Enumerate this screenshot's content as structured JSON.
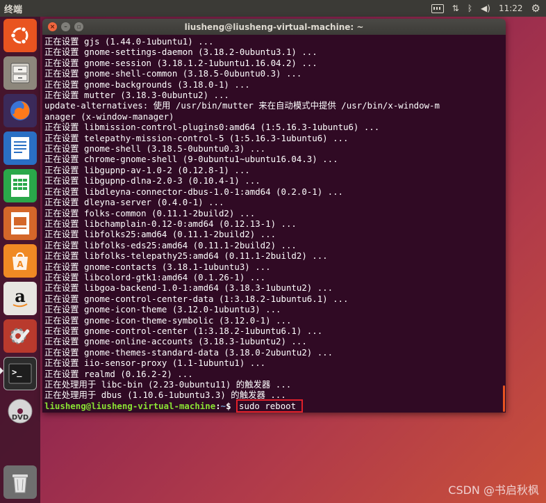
{
  "top_panel": {
    "app_title": "终端",
    "clock": "11:22",
    "icons": [
      "keyboard-icon",
      "network-icon",
      "bluetooth-icon",
      "volume-icon",
      "settings-icon"
    ]
  },
  "launcher": {
    "items": [
      {
        "name": "dash-home",
        "icon": "ubuntu-logo-icon",
        "color": "#e95420"
      },
      {
        "name": "files",
        "icon": "file-cabinet-icon",
        "color": "#a39e93"
      },
      {
        "name": "firefox",
        "icon": "firefox-icon",
        "color": "#ff7139"
      },
      {
        "name": "writer",
        "icon": "libreoffice-writer-icon",
        "color": "#2a6fc4"
      },
      {
        "name": "calc",
        "icon": "libreoffice-calc-icon",
        "color": "#2aa84a"
      },
      {
        "name": "impress",
        "icon": "libreoffice-impress-icon",
        "color": "#d4672a"
      },
      {
        "name": "software-center",
        "icon": "shopping-bag-icon",
        "color": "#f08a24"
      },
      {
        "name": "amazon",
        "icon": "amazon-icon",
        "color": "#e8e6e1"
      },
      {
        "name": "system-settings",
        "icon": "settings-wrench-icon",
        "color": "#b93a2d"
      },
      {
        "name": "terminal",
        "icon": "terminal-icon",
        "color": "#2c2c2c"
      },
      {
        "name": "dvd",
        "icon": "dvd-icon",
        "color": "#c9c9c9"
      },
      {
        "name": "trash",
        "icon": "trash-icon",
        "color": "#6f6f6f"
      }
    ]
  },
  "terminal": {
    "title": "liusheng@liusheng-virtual-machine: ~",
    "lines": [
      "正在设置 gjs (1.44.0-1ubuntu1) ...",
      "正在设置 gnome-settings-daemon (3.18.2-0ubuntu3.1) ...",
      "正在设置 gnome-session (3.18.1.2-1ubuntu1.16.04.2) ...",
      "正在设置 gnome-shell-common (3.18.5-0ubuntu0.3) ...",
      "正在设置 gnome-backgrounds (3.18.0-1) ...",
      "正在设置 mutter (3.18.3-0ubuntu2) ...",
      "update-alternatives: 使用 /usr/bin/mutter 来在自动模式中提供 /usr/bin/x-window-m",
      "anager (x-window-manager)",
      "正在设置 libmission-control-plugins0:amd64 (1:5.16.3-1ubuntu6) ...",
      "正在设置 telepathy-mission-control-5 (1:5.16.3-1ubuntu6) ...",
      "正在设置 gnome-shell (3.18.5-0ubuntu0.3) ...",
      "正在设置 chrome-gnome-shell (9-0ubuntu1~ubuntu16.04.3) ...",
      "正在设置 libgupnp-av-1.0-2 (0.12.8-1) ...",
      "正在设置 libgupnp-dlna-2.0-3 (0.10.4-1) ...",
      "正在设置 libdleyna-connector-dbus-1.0-1:amd64 (0.2.0-1) ...",
      "正在设置 dleyna-server (0.4.0-1) ...",
      "正在设置 folks-common (0.11.1-2build2) ...",
      "正在设置 libchamplain-0.12-0:amd64 (0.12.13-1) ...",
      "正在设置 libfolks25:amd64 (0.11.1-2build2) ...",
      "正在设置 libfolks-eds25:amd64 (0.11.1-2build2) ...",
      "正在设置 libfolks-telepathy25:amd64 (0.11.1-2build2) ...",
      "正在设置 gnome-contacts (3.18.1-1ubuntu3) ...",
      "正在设置 libcolord-gtk1:amd64 (0.1.26-1) ...",
      "正在设置 libgoa-backend-1.0-1:amd64 (3.18.3-1ubuntu2) ...",
      "正在设置 gnome-control-center-data (1:3.18.2-1ubuntu6.1) ...",
      "正在设置 gnome-icon-theme (3.12.0-1ubuntu3) ...",
      "正在设置 gnome-icon-theme-symbolic (3.12.0-1) ...",
      "正在设置 gnome-control-center (1:3.18.2-1ubuntu6.1) ...",
      "正在设置 gnome-online-accounts (3.18.3-1ubuntu2) ...",
      "正在设置 gnome-themes-standard-data (3.18.0-2ubuntu2) ...",
      "正在设置 iio-sensor-proxy (1.1-1ubuntu1) ...",
      "正在设置 realmd (0.16.2-2) ...",
      "正在处理用于 libc-bin (2.23-0ubuntu11) 的触发器 ...",
      "正在处理用于 dbus (1.10.6-1ubuntu3.3) 的触发器 ..."
    ],
    "prompt": {
      "user_host": "liusheng@liusheng-virtual-machine",
      "separator": ":",
      "path": "~",
      "symbol": "$ ",
      "command": "sudo reboot"
    }
  },
  "watermark": "CSDN @书启秋枫"
}
